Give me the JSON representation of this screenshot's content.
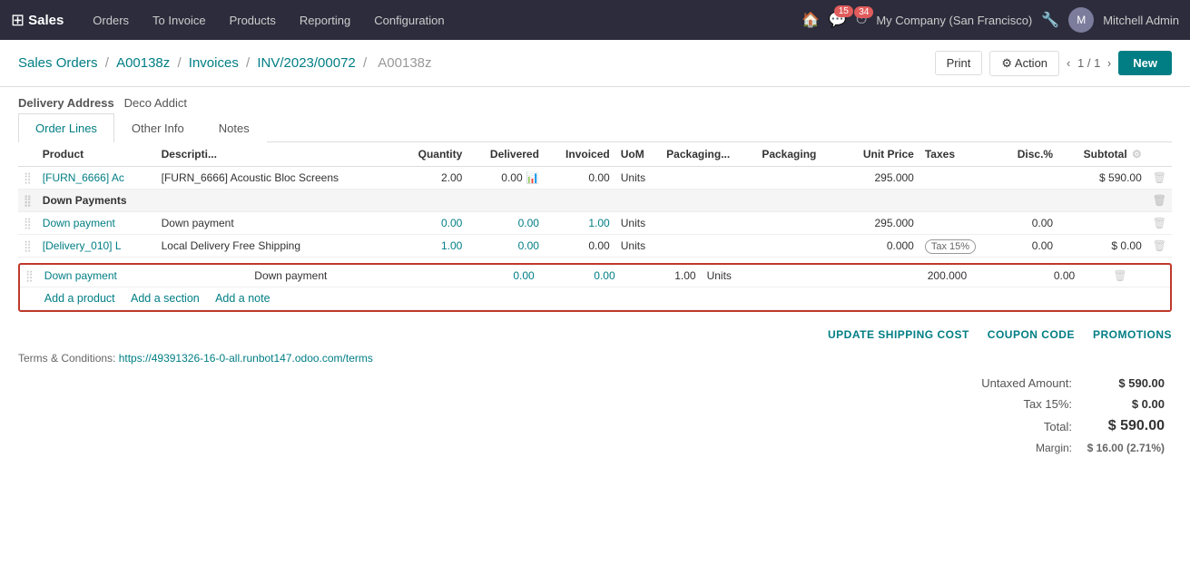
{
  "topnav": {
    "brand": "Sales",
    "menu": [
      "Orders",
      "To Invoice",
      "Products",
      "Reporting",
      "Configuration"
    ],
    "notifications_count": "15",
    "clock_count": "34",
    "company": "My Company (San Francisco)",
    "username": "Mitchell Admin"
  },
  "breadcrumb": {
    "items": [
      "Sales Orders",
      "A00138z",
      "Invoices",
      "INV/2023/00072",
      "A00138z"
    ],
    "separators": [
      "/",
      "/",
      "/",
      "/"
    ],
    "page_info": "1 / 1",
    "print_label": "Print",
    "action_label": "⚙ Action",
    "new_label": "New"
  },
  "delivery_address": {
    "label": "Delivery Address",
    "value": "Deco Addict"
  },
  "tabs": [
    "Order Lines",
    "Other Info",
    "Notes"
  ],
  "active_tab": "Order Lines",
  "table": {
    "headers": [
      "Product",
      "Descripti...",
      "Quantity",
      "Delivered",
      "Invoiced",
      "UoM",
      "Packaging...",
      "Packaging",
      "Unit Price",
      "Taxes",
      "Disc.%",
      "Subtotal"
    ],
    "rows": [
      {
        "product": "[FURN_6666] Ac",
        "description": "[FURN_6666] Acoustic Bloc Screens",
        "quantity": "2.00",
        "delivered": "0.00",
        "invoiced": "0.00",
        "uom": "Units",
        "packaging1": "",
        "packaging2": "",
        "unit_price": "295.000",
        "taxes": "",
        "disc": "",
        "subtotal": "$ 590.00"
      }
    ],
    "down_payments_section_label": "Down Payments",
    "down_payment_rows": [
      {
        "product": "Down payment",
        "description": "Down payment",
        "quantity": "0.00",
        "delivered": "0.00",
        "invoiced": "1.00",
        "uom": "Units",
        "packaging1": "",
        "packaging2": "",
        "unit_price": "295.000",
        "taxes": "",
        "disc": "0.00",
        "subtotal": ""
      },
      {
        "product": "[Delivery_010] L",
        "description": "Local Delivery Free Shipping",
        "quantity": "1.00",
        "delivered": "0.00",
        "invoiced": "0.00",
        "uom": "Units",
        "packaging1": "",
        "packaging2": "",
        "unit_price": "0.000",
        "taxes": "Tax 15%",
        "disc": "0.00",
        "subtotal": "$ 0.00"
      }
    ],
    "highlighted_row": {
      "product": "Down payment",
      "description": "Down payment",
      "quantity": "0.00",
      "delivered": "0.00",
      "invoiced": "1.00",
      "uom": "Units",
      "packaging1": "",
      "packaging2": "",
      "unit_price": "200.000",
      "taxes": "",
      "disc": "0.00",
      "subtotal": ""
    },
    "add_links": [
      "Add a product",
      "Add a section",
      "Add a note"
    ]
  },
  "footer": {
    "update_shipping": "UPDATE SHIPPING COST",
    "coupon_code": "COUPON CODE",
    "promotions": "PROMOTIONS"
  },
  "terms": {
    "label": "Terms & Conditions:",
    "link": "https://49391326-16-0-all.runbot147.odoo.com/terms"
  },
  "totals": {
    "untaxed_label": "Untaxed Amount:",
    "untaxed_value": "$ 590.00",
    "tax_label": "Tax 15%:",
    "tax_value": "$ 0.00",
    "total_label": "Total:",
    "total_value": "$ 590.00",
    "margin_label": "Margin:",
    "margin_value": "$ 16.00 (2.71%)"
  }
}
